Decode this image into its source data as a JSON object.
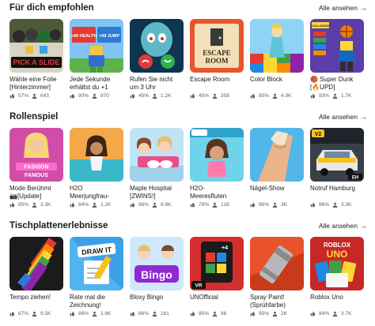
{
  "sections": [
    {
      "title": "Für dich empfohlen",
      "see_all": "Alle ansehen",
      "games": [
        {
          "name": "Wähle eine Folie\n[Hinterzimmer]",
          "rating": "57%",
          "players": "643",
          "thumb_icon": "pick-a-slide-thumbnail",
          "thumb_text": "PICK A SLIDE"
        },
        {
          "name": "Jede Sekunde\nerhältst du +1",
          "rating": "90%",
          "players": "970",
          "thumb_icon": "plus-health-jump-thumbnail",
          "thumb_text_1": "+99 HEALTH",
          "thumb_text_2": "+99 JUMP"
        },
        {
          "name": "Rufen Sie nicht\num 3 Uhr",
          "rating": "45%",
          "players": "1.2K",
          "thumb_icon": "squid-call-thumbnail"
        },
        {
          "name": "Escape Room",
          "rating": "45%",
          "players": "358",
          "thumb_icon": "escape-room-thumbnail",
          "thumb_text_1": "ESCAPE",
          "thumb_text_2": "ROOM"
        },
        {
          "name": "Color Block",
          "rating": "85%",
          "players": "4.9K",
          "thumb_icon": "color-block-thumbnail"
        },
        {
          "name": "🏀 Super Dunk\n[🔥UPD]",
          "rating": "93%",
          "players": "1.7K",
          "thumb_icon": "super-dunk-thumbnail",
          "thumb_text": "CHALLENGES"
        }
      ]
    },
    {
      "title": "Rollenspiel",
      "see_all": "Alle ansehen",
      "games": [
        {
          "name": "Mode Berühmt\n📷[Update]",
          "rating": "85%",
          "players": "3.3K",
          "thumb_icon": "fashion-famous-thumbnail",
          "thumb_text_1": "FASHION",
          "thumb_text_2": "FAMOUS"
        },
        {
          "name": "H2O\nMeerjungfrau-",
          "rating": "84%",
          "players": "1.2K",
          "thumb_icon": "mermaid-thumbnail"
        },
        {
          "name": "Maple Hospital\n[ZWINS!]",
          "rating": "86%",
          "players": "9.9K",
          "thumb_icon": "maple-hospital-thumbnail"
        },
        {
          "name": "H2O-\nMeeresfluten",
          "rating": "78%",
          "players": "138",
          "thumb_icon": "sea-tides-thumbnail"
        },
        {
          "name": "Nägel-Show",
          "rating": "96%",
          "players": "3K",
          "thumb_icon": "nail-show-thumbnail"
        },
        {
          "name": "Notruf Hamburg",
          "rating": "86%",
          "players": "3.3K",
          "thumb_icon": "emergency-hamburg-thumbnail",
          "thumb_text_1": "V2",
          "thumb_text_2": "EH"
        }
      ]
    },
    {
      "title": "Tischplattenerlebnisse",
      "see_all": "Alle ansehen",
      "games": [
        {
          "name": "Tempo ziehen!",
          "rating": "87%",
          "players": "9.5K",
          "thumb_icon": "paint-brush-thumbnail"
        },
        {
          "name": "Rate mal die\nZeichnung!",
          "rating": "89%",
          "players": "1.9K",
          "thumb_icon": "draw-it-thumbnail",
          "thumb_text": "DRAW IT"
        },
        {
          "name": "Bloxy Bingo",
          "rating": "86%",
          "players": "161",
          "thumb_icon": "bingo-thumbnail",
          "thumb_text": "Bingo"
        },
        {
          "name": "UNOfficial",
          "rating": "85%",
          "players": "96",
          "thumb_icon": "unofficial-cards-thumbnail",
          "thumb_text_1": "+4",
          "thumb_text_2": "VR"
        },
        {
          "name": "Spray Paint!\n(Sprühfarbe)",
          "rating": "95%",
          "players": "2K",
          "thumb_icon": "spray-paint-thumbnail"
        },
        {
          "name": "Roblox Uno",
          "rating": "84%",
          "players": "3.7K",
          "thumb_icon": "roblox-uno-thumbnail",
          "thumb_text_1": "ROBLOX",
          "thumb_text_2": "UNO"
        }
      ]
    }
  ]
}
